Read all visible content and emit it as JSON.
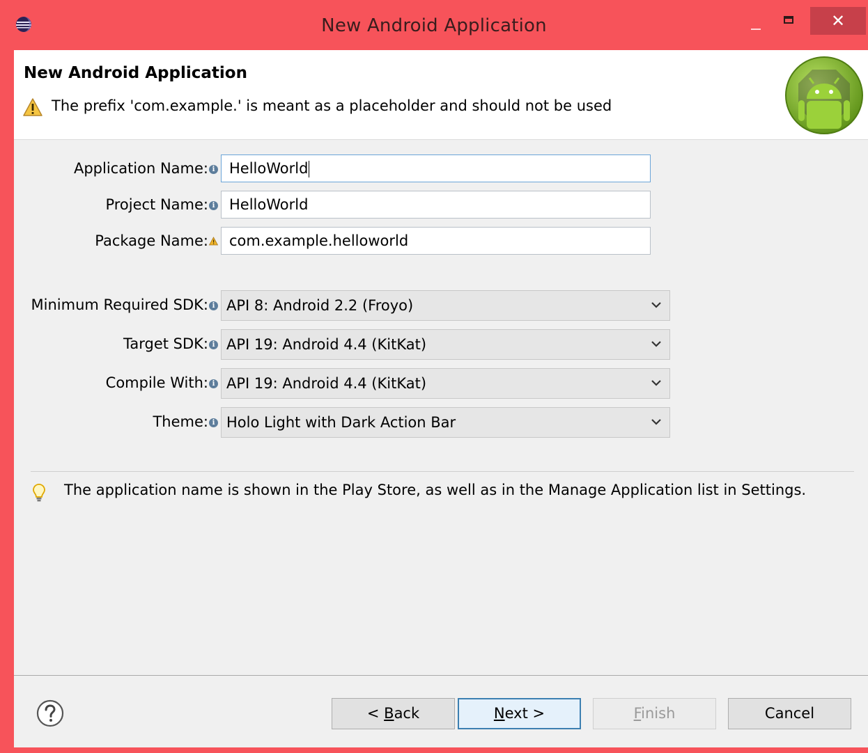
{
  "window": {
    "title": "New Android Application",
    "close_label": "✕"
  },
  "header": {
    "title": "New Android Application",
    "message": "The prefix 'com.example.' is meant as a placeholder and should not be used"
  },
  "form": {
    "application_name": {
      "label": "Application Name:",
      "value": "HelloWorld"
    },
    "project_name": {
      "label": "Project Name:",
      "value": "HelloWorld"
    },
    "package_name": {
      "label": "Package Name:",
      "value": "com.example.helloworld"
    },
    "min_sdk": {
      "label": "Minimum Required SDK:",
      "value": "API 8: Android 2.2 (Froyo)"
    },
    "target_sdk": {
      "label": "Target SDK:",
      "value": "API 19: Android 4.4 (KitKat)"
    },
    "compile_with": {
      "label": "Compile With:",
      "value": "API 19: Android 4.4 (KitKat)"
    },
    "theme": {
      "label": "Theme:",
      "value": "Holo Light with Dark Action Bar"
    }
  },
  "hint": "The application name is shown in the Play Store, as well as in the Manage Application list in Settings.",
  "buttons": {
    "back": {
      "prefix": "< ",
      "mnemonic": "B",
      "rest": "ack"
    },
    "next": {
      "mnemonic": "N",
      "rest": "ext >"
    },
    "finish": {
      "mnemonic": "F",
      "rest": "inish"
    },
    "cancel": "Cancel"
  },
  "colors": {
    "titlebar": "#f7535a",
    "close_button": "#c7404a",
    "default_button_border": "#3c7fb1"
  }
}
